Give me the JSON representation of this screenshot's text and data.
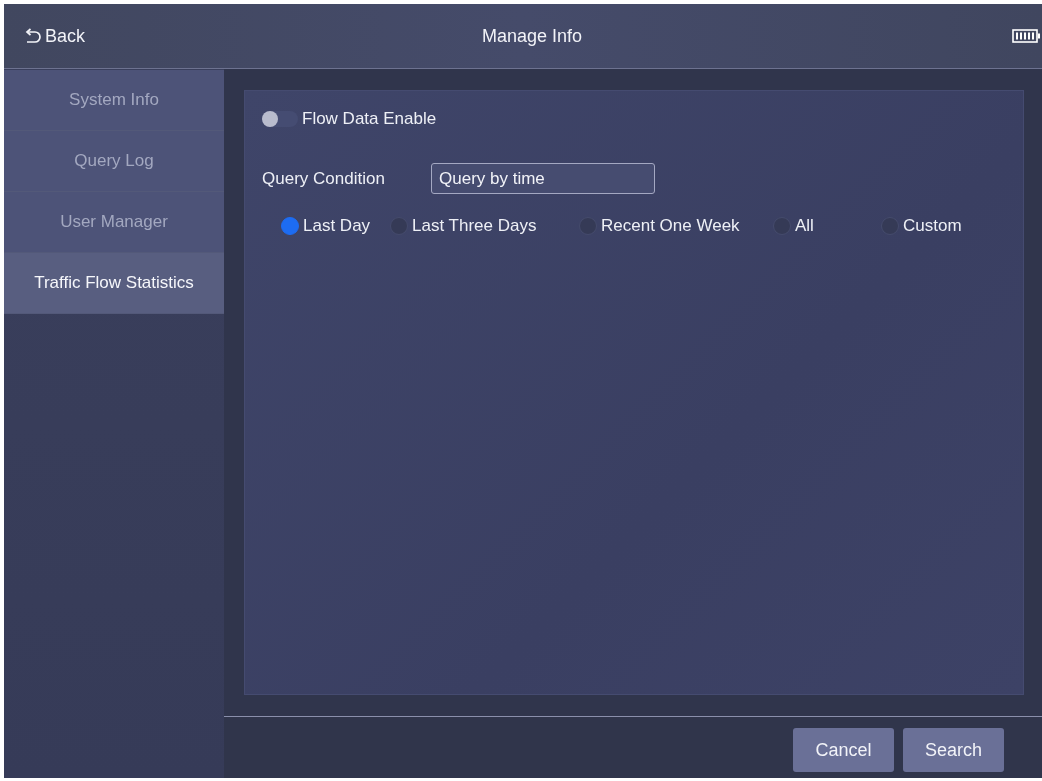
{
  "header": {
    "back": "Back",
    "title": "Manage Info"
  },
  "sidebar": {
    "items": [
      {
        "label": "System Info",
        "selected": false
      },
      {
        "label": "Query Log",
        "selected": false
      },
      {
        "label": "User Manager",
        "selected": false
      },
      {
        "label": "Traffic Flow Statistics",
        "selected": true
      }
    ]
  },
  "panel": {
    "flow_data": {
      "label": "Flow Data Enable",
      "on": false
    },
    "query_condition": {
      "label": "Query Condition",
      "value": "Query by time"
    },
    "time_ranges": [
      {
        "label": "Last Day",
        "selected": true
      },
      {
        "label": "Last Three Days",
        "selected": false
      },
      {
        "label": "Recent One Week",
        "selected": false
      },
      {
        "label": "All",
        "selected": false
      },
      {
        "label": "Custom",
        "selected": false
      }
    ]
  },
  "buttons": [
    "Cancel",
    "Search"
  ]
}
